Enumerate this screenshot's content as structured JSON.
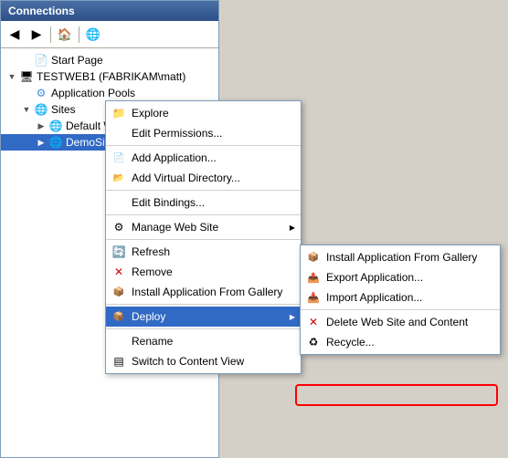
{
  "panel": {
    "title": "Connections",
    "toolbar": {
      "back_tooltip": "Back",
      "forward_tooltip": "Forward",
      "home_tooltip": "Home",
      "help_tooltip": "Help"
    }
  },
  "tree": {
    "items": [
      {
        "id": "start-page",
        "label": "Start Page",
        "level": 0,
        "icon": "page"
      },
      {
        "id": "server",
        "label": "TESTWEB1 (FABRIKAM\\matt)",
        "level": 0,
        "icon": "server",
        "expanded": true
      },
      {
        "id": "app-pools",
        "label": "Application Pools",
        "level": 1,
        "icon": "app-pool"
      },
      {
        "id": "sites",
        "label": "Sites",
        "level": 1,
        "icon": "sites",
        "expanded": true
      },
      {
        "id": "default-site",
        "label": "Default Web Site",
        "level": 2,
        "icon": "site",
        "expanded": false
      },
      {
        "id": "demo-site",
        "label": "DemoSite",
        "level": 2,
        "icon": "site",
        "selected": true
      }
    ]
  },
  "context_menu": {
    "items": [
      {
        "id": "explore",
        "label": "Explore",
        "icon": "folder",
        "separator_after": false
      },
      {
        "id": "edit-permissions",
        "label": "Edit Permissions...",
        "icon": null,
        "separator_after": true
      },
      {
        "id": "add-application",
        "label": "Add Application...",
        "icon": "app",
        "separator_after": false
      },
      {
        "id": "add-virtual-dir",
        "label": "Add Virtual Directory...",
        "icon": "vdir",
        "separator_after": true
      },
      {
        "id": "edit-bindings",
        "label": "Edit Bindings...",
        "icon": null,
        "separator_after": true
      },
      {
        "id": "manage-web-site",
        "label": "Manage Web Site",
        "icon": "gear",
        "has_submenu": true,
        "separator_after": true
      },
      {
        "id": "refresh",
        "label": "Refresh",
        "icon": "refresh",
        "separator_after": false
      },
      {
        "id": "remove",
        "label": "Remove",
        "icon": "remove",
        "separator_after": false
      },
      {
        "id": "install-gallery",
        "label": "Install Application From Gallery",
        "icon": "install",
        "separator_after": true
      },
      {
        "id": "deploy",
        "label": "Deploy",
        "icon": "deploy",
        "has_submenu": true,
        "highlighted": true,
        "separator_after": true
      },
      {
        "id": "rename",
        "label": "Rename",
        "icon": null,
        "separator_after": false
      },
      {
        "id": "switch-content",
        "label": "Switch to Content View",
        "icon": "switch",
        "separator_after": false
      }
    ]
  },
  "submenu": {
    "items": [
      {
        "id": "install-gallery-sub",
        "label": "Install Application From Gallery",
        "icon": "install"
      },
      {
        "id": "export-app",
        "label": "Export Application...",
        "icon": "export"
      },
      {
        "id": "import-app",
        "label": "Import Application...",
        "icon": "import",
        "highlighted": true
      },
      {
        "id": "delete-site",
        "label": "Delete Web Site and Content",
        "icon": "delete"
      },
      {
        "id": "recycle",
        "label": "Recycle...",
        "icon": "recycle"
      }
    ]
  },
  "icons": {
    "back": "◀",
    "forward": "▶",
    "home": "🏠",
    "help": "?",
    "folder": "📁",
    "page": "📄",
    "server": "🖥",
    "app_pool": "⚙",
    "sites": "🌐",
    "site": "🌐",
    "gear": "⚙",
    "refresh": "🔄",
    "remove": "✕",
    "install": "📦",
    "deploy": "📦",
    "switch": "▤",
    "export": "📤",
    "import": "📥",
    "delete": "✕",
    "recycle": "♻"
  }
}
